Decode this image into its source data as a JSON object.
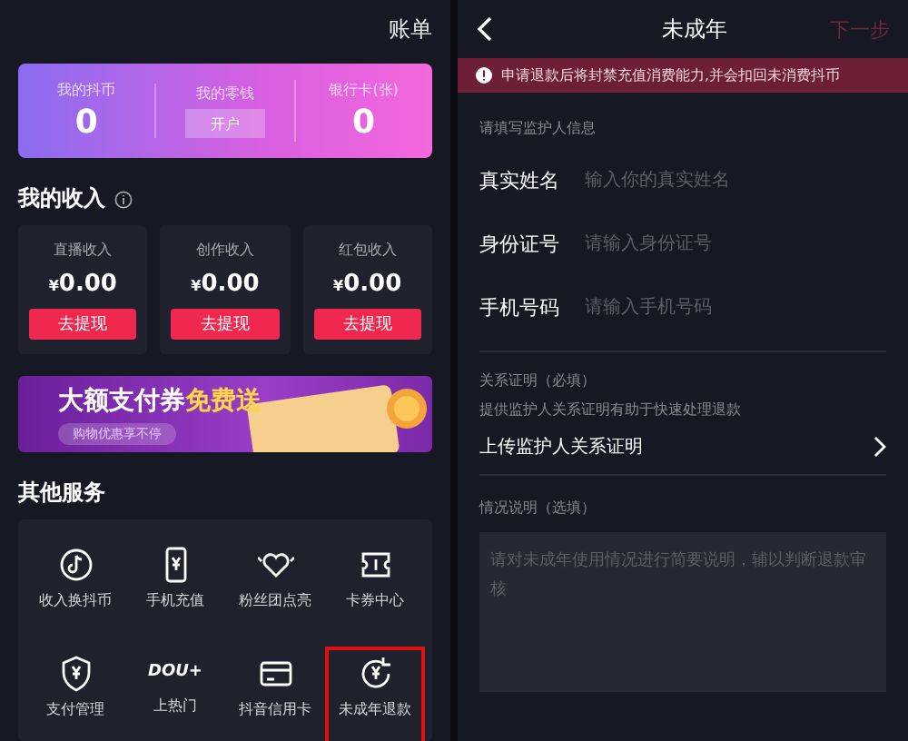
{
  "left_screen": {
    "header_link": "账单",
    "wallet": [
      {
        "label": "我的抖币",
        "value": "0",
        "kind": "number"
      },
      {
        "label": "我的零钱",
        "value": "开户",
        "kind": "button"
      },
      {
        "label": "银行卡(张)",
        "value": "0",
        "kind": "number"
      }
    ],
    "income": {
      "title": "我的收入",
      "cards": [
        {
          "label": "直播收入",
          "amount": "0.00",
          "currency": "¥",
          "button": "去提现"
        },
        {
          "label": "创作收入",
          "amount": "0.00",
          "currency": "¥",
          "button": "去提现"
        },
        {
          "label": "红包收入",
          "amount": "0.00",
          "currency": "¥",
          "button": "去提现"
        }
      ]
    },
    "banner": {
      "headline": "大额支付券",
      "headline_accent": "免费送",
      "subtitle": "购物优惠享不停"
    },
    "services": {
      "title": "其他服务",
      "items": [
        {
          "label": "收入换抖币",
          "kind": "icon",
          "highlighted": false
        },
        {
          "label": "手机充值",
          "kind": "icon",
          "highlighted": false
        },
        {
          "label": "粉丝团点亮",
          "kind": "icon",
          "highlighted": false
        },
        {
          "label": "卡券中心",
          "kind": "icon",
          "highlighted": false
        },
        {
          "label": "支付管理",
          "kind": "icon",
          "highlighted": false
        },
        {
          "label": "上热门",
          "kind": "logo",
          "logo_text": "DOU+",
          "highlighted": false
        },
        {
          "label": "抖音信用卡",
          "kind": "icon",
          "highlighted": false
        },
        {
          "label": "未成年退款",
          "kind": "icon",
          "highlighted": true
        }
      ]
    }
  },
  "right_screen": {
    "title": "未成年",
    "next_button": {
      "label": "下一步",
      "disabled": true
    },
    "warning": "申请退款后将封禁充值消费能力,并会扣回未消费抖币",
    "guardian_heading": "请填写监护人信息",
    "fields": [
      {
        "label": "真实姓名",
        "placeholder": "输入你的真实姓名"
      },
      {
        "label": "身份证号",
        "placeholder": "请输入身份证号"
      },
      {
        "label": "手机号码",
        "placeholder": "请输入手机号码"
      }
    ],
    "proof": {
      "heading": "关系证明（必填）",
      "hint": "提供监护人关系证明有助于快速处理退款",
      "upload_label": "上传监护人关系证明"
    },
    "notes": {
      "heading": "情况说明（选填）",
      "placeholder": "请对未成年使用情况进行简要说明，辅以判断退款审核"
    }
  }
}
